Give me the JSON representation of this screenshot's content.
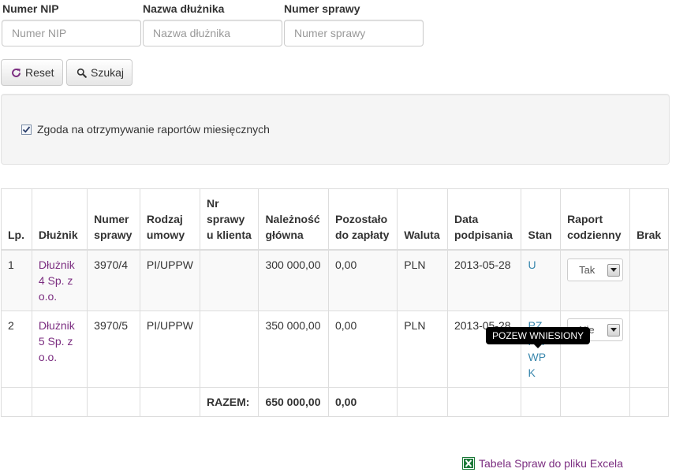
{
  "filters": {
    "nip_label": "Numer NIP",
    "nip_placeholder": "Numer NIP",
    "debtor_label": "Nazwa dłużnika",
    "debtor_placeholder": "Nazwa dłużnika",
    "case_label": "Numer sprawy",
    "case_placeholder": "Numer sprawy"
  },
  "buttons": {
    "reset_label": "Reset",
    "search_label": "Szukaj"
  },
  "consent": {
    "label": "Zgoda na otrzymywanie raportów miesięcznych",
    "checked": true
  },
  "table": {
    "headers": {
      "lp": "Lp.",
      "debtor": "Dłużnik",
      "case_number": "Numer sprawy",
      "contract_type": "Rodzaj umowy",
      "client_case_number": "Nr sprawy u klienta",
      "principal": "Należność główna",
      "remaining": "Pozostało do zapłaty",
      "currency": "Waluta",
      "signing_date": "Data podpisania",
      "status": "Stan",
      "daily_report": "Raport codzienny",
      "missing": "Brak"
    },
    "rows": [
      {
        "lp": "1",
        "debtor": "Dłużnik 4 Sp. z o.o.",
        "case_number": "3970/4",
        "contract_type": "PI/UPPW",
        "client_case_number": "",
        "principal": "300 000,00",
        "remaining": "0,00",
        "currency": "PLN",
        "signing_date": "2013-05-28",
        "status_links": [
          "U"
        ],
        "daily_report": "Tak",
        "missing": ""
      },
      {
        "lp": "2",
        "debtor": "Dłużnik 5 Sp. z o.o.",
        "case_number": "3970/5",
        "contract_type": "PI/UPPW",
        "client_case_number": "",
        "principal": "350 000,00",
        "remaining": "0,00",
        "currency": "PLN",
        "signing_date": "2013-05-28",
        "status_links": [
          "PZ",
          "PW",
          "WP",
          "K"
        ],
        "daily_report": "Nie",
        "missing": ""
      }
    ],
    "footer": {
      "label": "RAZEM:",
      "principal_total": "650 000,00",
      "remaining_total": "0,00"
    }
  },
  "tooltip": {
    "text": "POZEW WNIESIONY"
  },
  "export": {
    "label": "Tabela Spraw do pliku Excela",
    "icon": "excel-icon"
  },
  "colors": {
    "link_purple": "#7b2d80",
    "status_link_blue": "#3a87ad",
    "excel_green": "#1d7a3a",
    "tooltip_bg": "#000000"
  }
}
